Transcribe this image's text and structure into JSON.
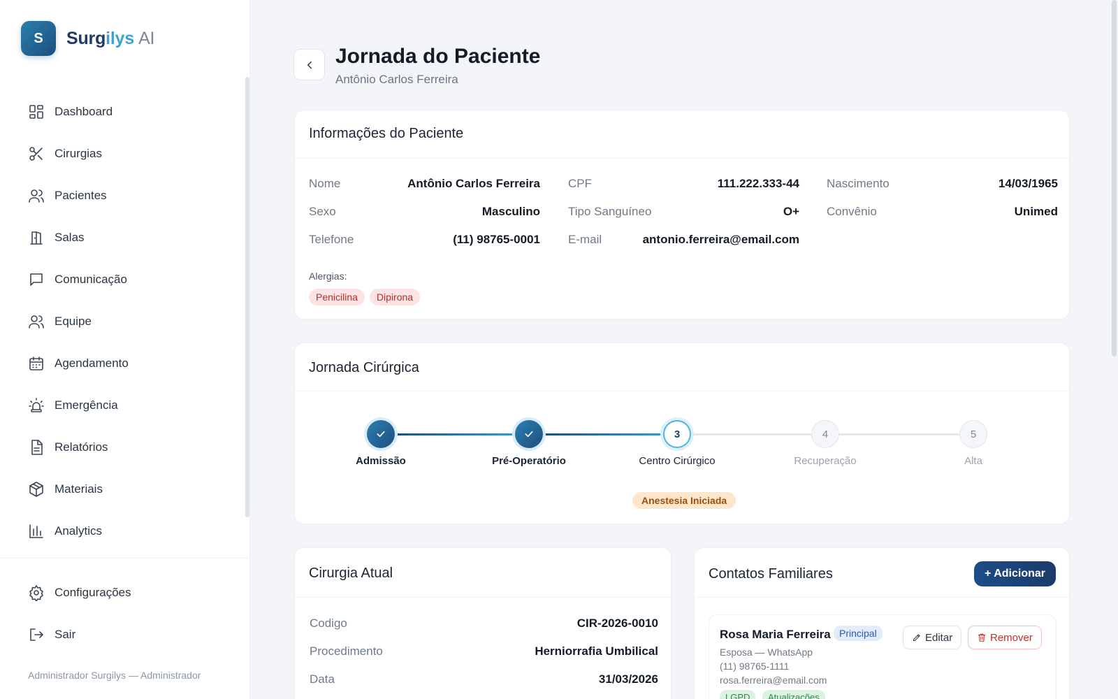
{
  "app": {
    "logo_letter": "S",
    "name_part1": "Surg",
    "name_part2": "ilys",
    "name_part3": "AI"
  },
  "sidebar": {
    "items": [
      {
        "label": "Dashboard",
        "icon": "grid-icon"
      },
      {
        "label": "Cirurgias",
        "icon": "scissors-icon"
      },
      {
        "label": "Pacientes",
        "icon": "users-icon"
      },
      {
        "label": "Salas",
        "icon": "door-icon"
      },
      {
        "label": "Comunicação",
        "icon": "chat-icon"
      },
      {
        "label": "Equipe",
        "icon": "team-icon"
      },
      {
        "label": "Agendamento",
        "icon": "calendar-icon"
      },
      {
        "label": "Emergência",
        "icon": "siren-icon"
      },
      {
        "label": "Relatórios",
        "icon": "document-icon"
      },
      {
        "label": "Materiais",
        "icon": "box-icon"
      },
      {
        "label": "Analytics",
        "icon": "bar-chart-icon"
      }
    ],
    "bottom": [
      {
        "label": "Configurações",
        "icon": "gear-icon"
      },
      {
        "label": "Sair",
        "icon": "logout-icon"
      }
    ],
    "footer": "Administrador Surgilys — Administrador"
  },
  "header": {
    "title": "Jornada do Paciente",
    "subtitle": "Antônio Carlos Ferreira"
  },
  "patient_info": {
    "title": "Informações do Paciente",
    "rows": [
      [
        {
          "key": "Nome",
          "value": "Antônio Carlos Ferreira"
        },
        {
          "key": "CPF",
          "value": "111.222.333-44"
        },
        {
          "key": "Nascimento",
          "value": "14/03/1965"
        }
      ],
      [
        {
          "key": "Sexo",
          "value": "Masculino"
        },
        {
          "key": "Tipo Sanguíneo",
          "value": "O+"
        },
        {
          "key": "Convênio",
          "value": "Unimed"
        }
      ],
      [
        {
          "key": "Telefone",
          "value": "(11) 98765-0001"
        },
        {
          "key": "E-mail",
          "value": "antonio.ferreira@email.com"
        }
      ]
    ],
    "allergies_label": "Alergias:",
    "allergies": [
      "Penicilina",
      "Dipirona"
    ]
  },
  "journey": {
    "title": "Jornada Cirúrgica",
    "steps": [
      {
        "number": "1",
        "label": "Admissão",
        "state": "done"
      },
      {
        "number": "2",
        "label": "Pré-Operatório",
        "state": "done"
      },
      {
        "number": "3",
        "label": "Centro Cirúrgico",
        "state": "active"
      },
      {
        "number": "4",
        "label": "Recuperação",
        "state": "pending"
      },
      {
        "number": "5",
        "label": "Alta",
        "state": "pending"
      }
    ],
    "status": "Anestesia Iniciada",
    "colors": {
      "done": "#1e4f7e",
      "active": "#52b3e3",
      "pending": "#e2e6eb",
      "status_bg": "#fde7cc"
    }
  },
  "surgery": {
    "title": "Cirurgia Atual",
    "fields": [
      {
        "key": "Codigo",
        "value": "CIR-2026-0010"
      },
      {
        "key": "Procedimento",
        "value": "Herniorrafia Umbilical"
      },
      {
        "key": "Data",
        "value": "31/03/2026"
      }
    ]
  },
  "family": {
    "title": "Contatos Familiares",
    "add_label": "+ Adicionar",
    "contacts": [
      {
        "name": "Rosa Maria Ferreira",
        "badge": "Principal",
        "relation": "Esposa — WhatsApp",
        "phone": "(11) 98765-1111",
        "email": "rosa.ferreira@email.com",
        "edit_label": "Editar",
        "remove_label": "Remover",
        "tags": [
          "LGPD",
          "Atualizações"
        ]
      }
    ]
  }
}
